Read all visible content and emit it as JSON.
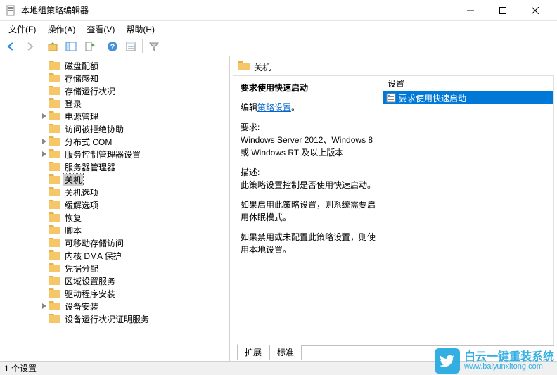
{
  "window": {
    "title": "本地组策略编辑器"
  },
  "menu": {
    "file": "文件(F)",
    "action": "操作(A)",
    "view": "查看(V)",
    "help": "帮助(H)"
  },
  "tree": {
    "items": [
      {
        "label": "磁盘配额",
        "expandable": false
      },
      {
        "label": "存储感知",
        "expandable": false
      },
      {
        "label": "存储运行状况",
        "expandable": false
      },
      {
        "label": "登录",
        "expandable": false
      },
      {
        "label": "电源管理",
        "expandable": true
      },
      {
        "label": "访问被拒绝协助",
        "expandable": false
      },
      {
        "label": "分布式 COM",
        "expandable": true
      },
      {
        "label": "服务控制管理器设置",
        "expandable": true
      },
      {
        "label": "服务器管理器",
        "expandable": false
      },
      {
        "label": "关机",
        "expandable": false,
        "selected": true
      },
      {
        "label": "关机选项",
        "expandable": false
      },
      {
        "label": "缓解选项",
        "expandable": false
      },
      {
        "label": "恢复",
        "expandable": false
      },
      {
        "label": "脚本",
        "expandable": false
      },
      {
        "label": "可移动存储访问",
        "expandable": false
      },
      {
        "label": "内核 DMA 保护",
        "expandable": false
      },
      {
        "label": "凭据分配",
        "expandable": false
      },
      {
        "label": "区域设置服务",
        "expandable": false
      },
      {
        "label": "驱动程序安装",
        "expandable": false
      },
      {
        "label": "设备安装",
        "expandable": true
      },
      {
        "label": "设备运行状况证明服务",
        "expandable": false
      }
    ]
  },
  "right": {
    "header": "关机",
    "policy_name": "要求使用快速启动",
    "edit_prefix": "编辑",
    "edit_link": "策略设置",
    "req_label": "要求:",
    "req_text": "Windows Server 2012、Windows 8 或 Windows RT 及以上版本",
    "desc_label": "描述:",
    "desc1": "此策略设置控制是否使用快速启动。",
    "desc2": "如果启用此策略设置，则系统需要启用休眠模式。",
    "desc3": "如果禁用或未配置此策略设置，则使用本地设置。",
    "list_header": "设置",
    "list_item": "要求使用快速启动"
  },
  "tabs": {
    "extended": "扩展",
    "standard": "标准"
  },
  "status": "1 个设置",
  "watermark": {
    "text": "白云一键重装系统",
    "url": "www.baiyunxitong.com"
  }
}
